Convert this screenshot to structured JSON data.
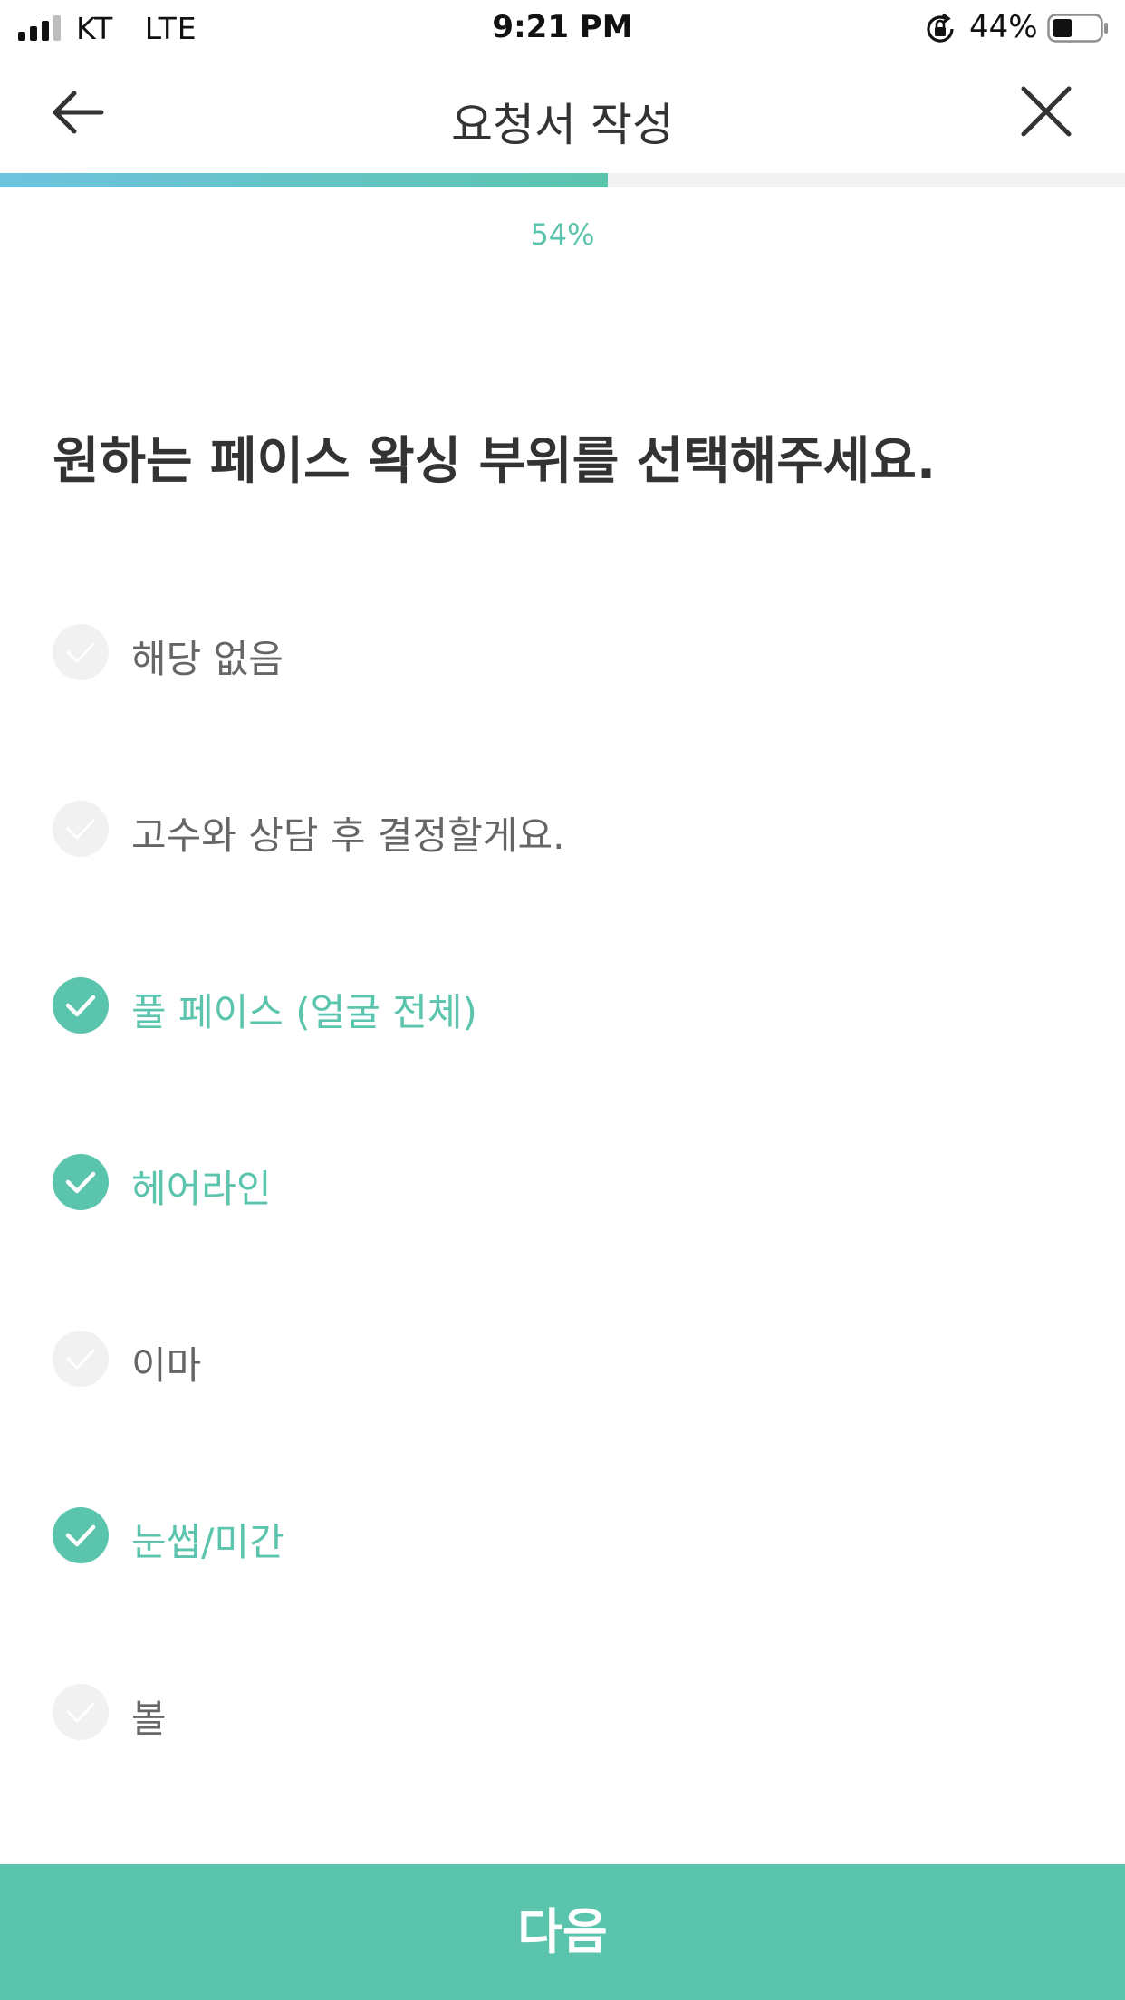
{
  "status_bar": {
    "carrier": "KT",
    "network": "LTE",
    "time": "9:21 PM",
    "battery_percent": "44%",
    "battery_level": 0.44,
    "icons": [
      "signal-icon",
      "orientation-lock-icon",
      "battery-icon"
    ]
  },
  "header": {
    "title": "요청서 작성",
    "back_icon": "back-arrow-icon",
    "close_icon": "close-icon"
  },
  "progress": {
    "value": 0.54,
    "label": "54%",
    "colors": {
      "start": "#6ec3df",
      "end": "#5bc4ac",
      "track": "#f2f2f2"
    }
  },
  "question": "원하는 페이스 왁싱 부위를 선택해주세요.",
  "options": [
    {
      "label": "해당 없음",
      "selected": false
    },
    {
      "label": "고수와 상담 후 결정할게요.",
      "selected": false
    },
    {
      "label": "풀 페이스 (얼굴 전체)",
      "selected": true
    },
    {
      "label": "헤어라인",
      "selected": true
    },
    {
      "label": "이마",
      "selected": false
    },
    {
      "label": "눈썹/미간",
      "selected": true
    },
    {
      "label": "볼",
      "selected": false
    }
  ],
  "next_button": {
    "label": "다음"
  },
  "colors": {
    "accent": "#5bc4ac",
    "unselected_circle": "#f1f1f1",
    "unselected_text": "#666666"
  }
}
